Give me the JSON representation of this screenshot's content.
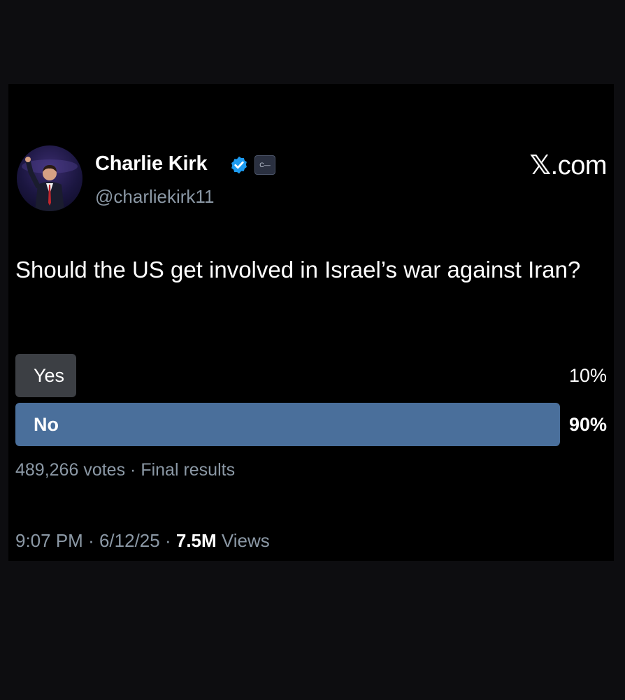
{
  "author": {
    "display_name": "Charlie Kirk",
    "handle": "@charliekirk11",
    "verified": true,
    "affiliate_badge_text": "C—"
  },
  "brand": {
    "x_glyph": "𝕏",
    "domain": ".com"
  },
  "tweet": {
    "text": "Should the US get involved in Israel’s war against Iran?"
  },
  "poll": {
    "options": [
      {
        "label": "Yes",
        "percent_text": "10%",
        "share": 0.1,
        "winner": false
      },
      {
        "label": "No",
        "percent_text": "90%",
        "share": 0.9,
        "winner": true
      }
    ],
    "votes": "489,266 votes",
    "separator": "·",
    "status": "Final results"
  },
  "meta": {
    "time": "9:07 PM",
    "date": "6/12/25",
    "separator": "·",
    "views_count": "7.5M",
    "views_label": "Views"
  },
  "colors": {
    "background": "#0d0d10",
    "card": "#000000",
    "poll_winner": "#4a6f9b",
    "poll_other": "#3c3f44",
    "verified_blue": "#1d9bf0",
    "secondary_text": "#8b98a5"
  },
  "icons": {
    "verified": "verified-check-icon",
    "affiliate": "affiliate-badge-icon"
  }
}
